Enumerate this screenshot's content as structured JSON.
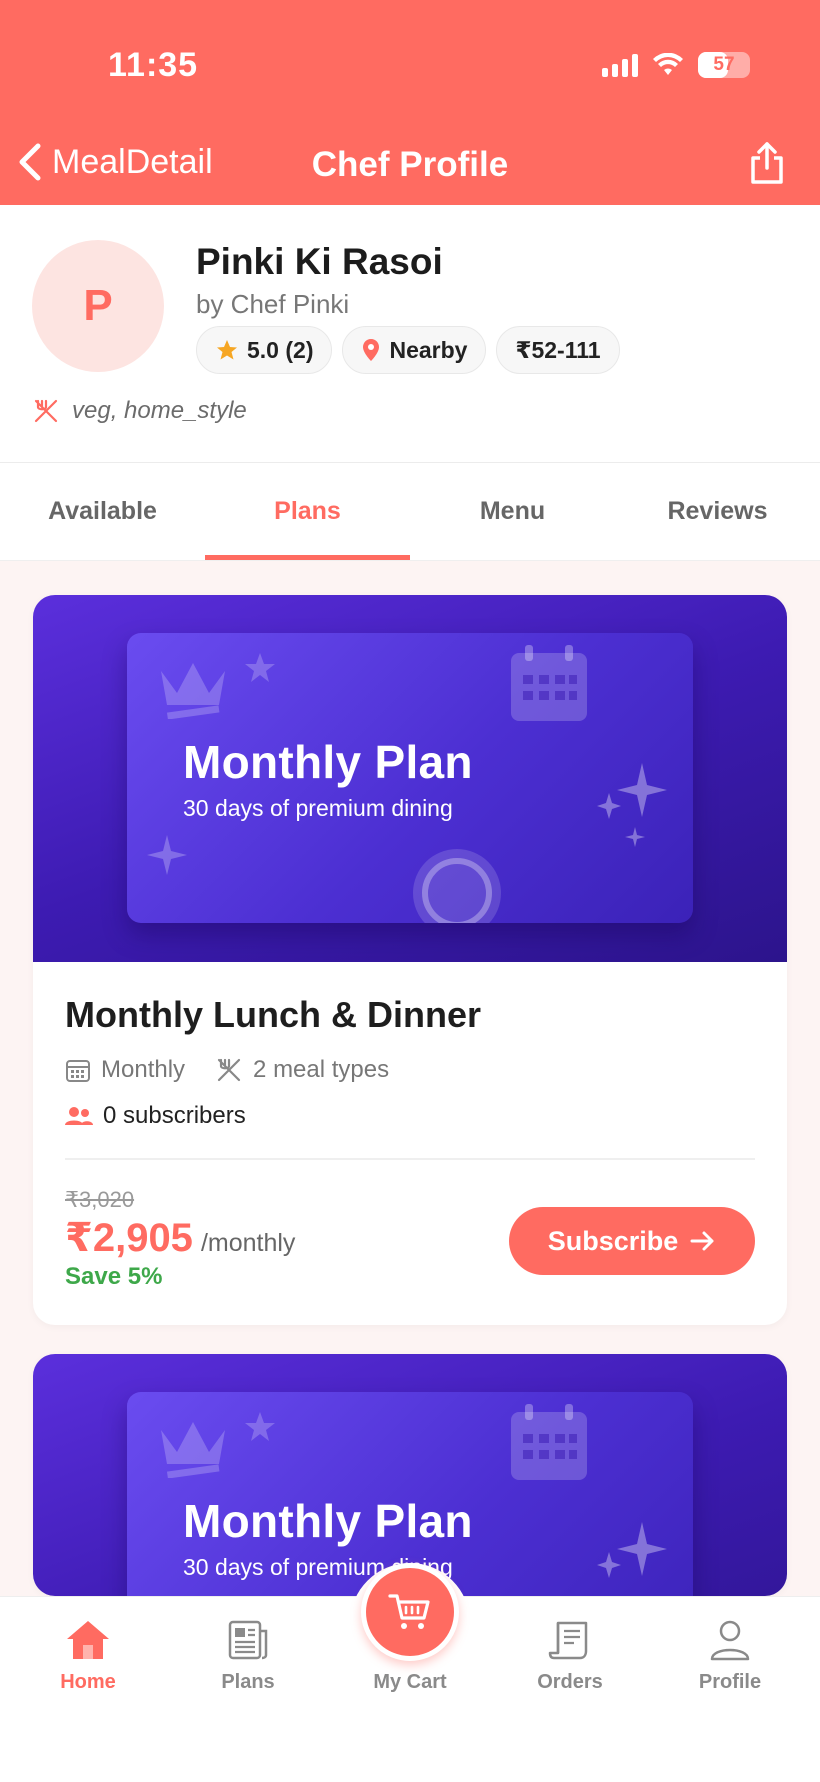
{
  "status_bar": {
    "time": "11:35",
    "battery": "57",
    "battery_level": 0.57
  },
  "header": {
    "back_label": "MealDetail",
    "title": "Chef Profile"
  },
  "chef": {
    "avatar_letter": "P",
    "name": "Pinki Ki Rasoi",
    "by_line": "by Chef Pinki",
    "rating": "5.0 (2)",
    "distance": "Nearby",
    "price_range": "₹52-111",
    "cuisine": "veg, home_style"
  },
  "tabs": [
    {
      "label": "Available"
    },
    {
      "label": "Plans"
    },
    {
      "label": "Menu"
    },
    {
      "label": "Reviews"
    }
  ],
  "plans": [
    {
      "banner_title": "Monthly Plan",
      "banner_subtitle": "30 days of premium dining",
      "title": "Monthly Lunch & Dinner",
      "frequency": "Monthly",
      "meal_types": "2 meal types",
      "subscribers": "0 subscribers",
      "old_price": "₹3,020",
      "price": "₹2,905",
      "period": "/monthly",
      "savings": "Save 5%",
      "button": "Subscribe"
    },
    {
      "banner_title": "Monthly Plan",
      "banner_subtitle": "30 days of premium dining"
    }
  ],
  "bottom_nav": {
    "home": "Home",
    "plans": "Plans",
    "cart": "My Cart",
    "orders": "Orders",
    "profile": "Profile"
  },
  "colors": {
    "accent": "#ff6b61",
    "banner": "#3d1bb2",
    "success": "#3ea84a"
  },
  "icons": [
    "back-chevron-icon",
    "share-icon",
    "star-icon",
    "location-pin-icon",
    "utensils-icon",
    "calendar-icon",
    "users-icon",
    "arrow-right-icon",
    "crown-icon",
    "sparkle-icon",
    "home-icon",
    "newspaper-icon",
    "cart-icon",
    "receipt-icon",
    "person-icon"
  ]
}
